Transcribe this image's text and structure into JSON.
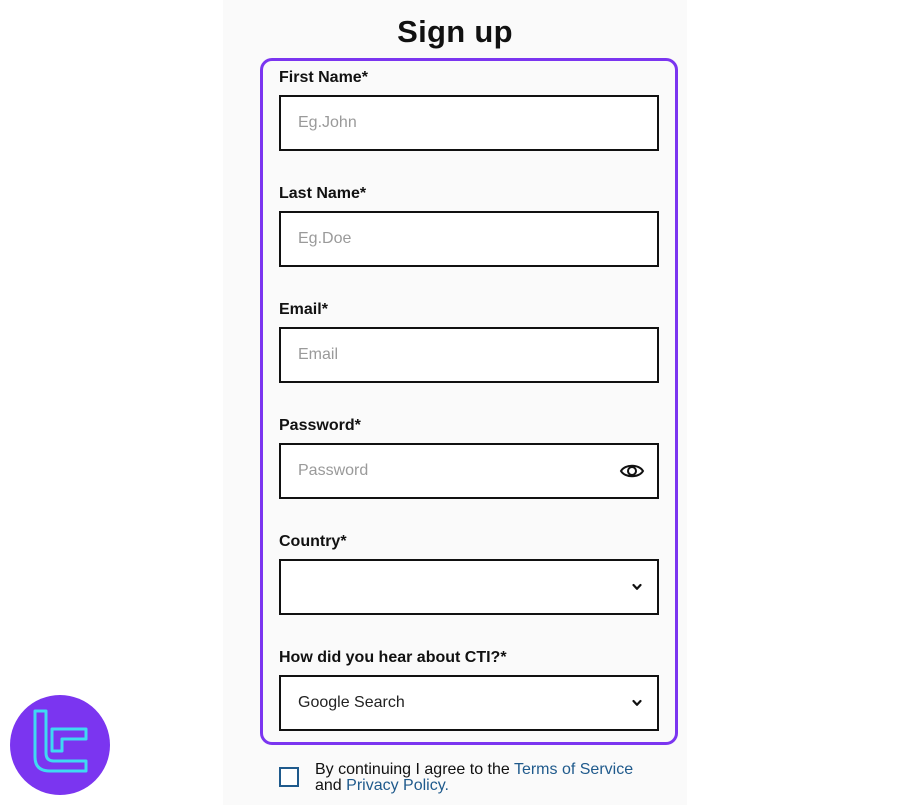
{
  "page": {
    "title": "Sign up"
  },
  "form": {
    "first_name": {
      "label": "First Name*",
      "placeholder": "Eg.John",
      "value": ""
    },
    "last_name": {
      "label": "Last Name*",
      "placeholder": "Eg.Doe",
      "value": ""
    },
    "email": {
      "label": "Email*",
      "placeholder": "Email",
      "value": ""
    },
    "password": {
      "label": "Password*",
      "placeholder": "Password",
      "value": "",
      "toggle_icon": "eye-icon"
    },
    "country": {
      "label": "Country*",
      "selected": "",
      "icon": "chevron-down-icon"
    },
    "referral": {
      "label": "How did you hear about CTI?*",
      "selected": "Google Search",
      "icon": "chevron-down-icon"
    }
  },
  "consent": {
    "checked": false,
    "text_before": "By continuing I agree to the ",
    "terms_link": "Terms of Service",
    "text_middle": "and ",
    "privacy_link": "Privacy Policy."
  },
  "brand": {
    "icon": "brand-logo-icon"
  },
  "colors": {
    "accent_frame": "#7b35f0",
    "link": "#1f5a8c",
    "logo_glyph": "#3fd9f2"
  }
}
